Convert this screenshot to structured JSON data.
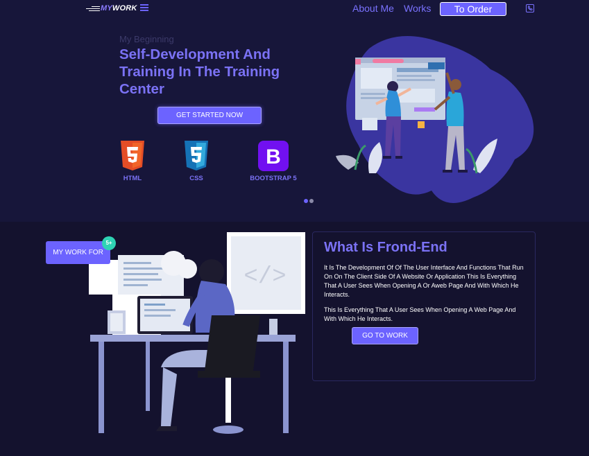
{
  "header": {
    "logo_my": "MY",
    "logo_work": "WORK",
    "nav": {
      "about": "About Me",
      "works": "Works"
    },
    "order_button": "To Order",
    "phone_icon": "phone-icon"
  },
  "hero": {
    "eyebrow": "My Beginning",
    "title": "Self-Development And Training In The Training Center",
    "cta": "GET STARTED NOW",
    "technologies": [
      {
        "name": "HTML",
        "badge": "5",
        "color": "#e44d26"
      },
      {
        "name": "CSS",
        "badge": "3",
        "color": "#1572b6"
      },
      {
        "name": "BOOTSTRAP 5",
        "badge": "B",
        "color": "#7110f1"
      }
    ],
    "carousel": {
      "total": 2,
      "active": 1
    }
  },
  "work": {
    "badge": "MY WORK FOR",
    "badge_plus": "5+",
    "code_symbol": "</>",
    "card": {
      "title": "What Is Frond-End",
      "paragraph1": "It Is The Development Of Of The User Interface And Functions That Run On On The Client Side Of A Website Or Application This Is Everything That A User Sees When Opening A Or Aweb Page And With Which He Interacts.",
      "paragraph2": "This Is Everything That A User Sees When Opening A Web Page And With Which He Interacts.",
      "button": "GO TO WORK"
    }
  },
  "colors": {
    "accent": "#6c63ff",
    "title": "#7b72f5",
    "background": "#14122e",
    "badge": "#2fd3b4"
  }
}
